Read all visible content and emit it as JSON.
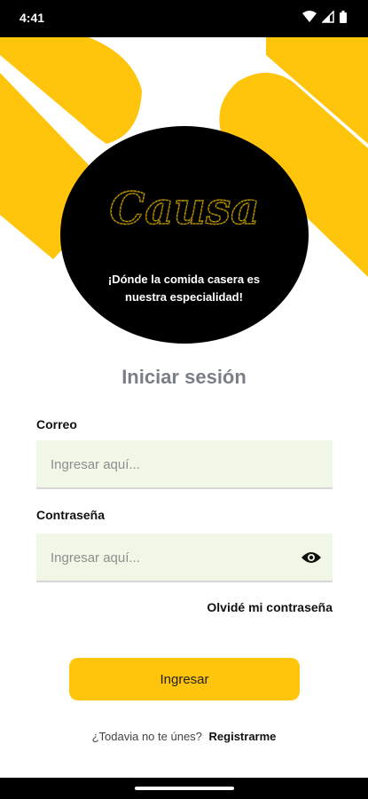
{
  "status_bar": {
    "time": "4:41"
  },
  "hero": {
    "logo_text": "Causa",
    "tagline_line1": "¡Dónde la comida casera es",
    "tagline_line2": "nuestra especialidad!"
  },
  "login": {
    "title": "Iniciar sesión",
    "email_label": "Correo",
    "email_placeholder": "Ingresar aquí...",
    "password_label": "Contraseña",
    "password_placeholder": "Ingresar aquí...",
    "forgot_password": "Olvidé mi contraseña",
    "submit_label": "Ingresar",
    "register_prompt": "¿Todavia no te únes?",
    "register_link": "Registrarme"
  },
  "colors": {
    "accent": "#ffc40c",
    "circle": "#000000",
    "field_bg": "#f1f7e6",
    "title_color": "#7a7f87"
  }
}
